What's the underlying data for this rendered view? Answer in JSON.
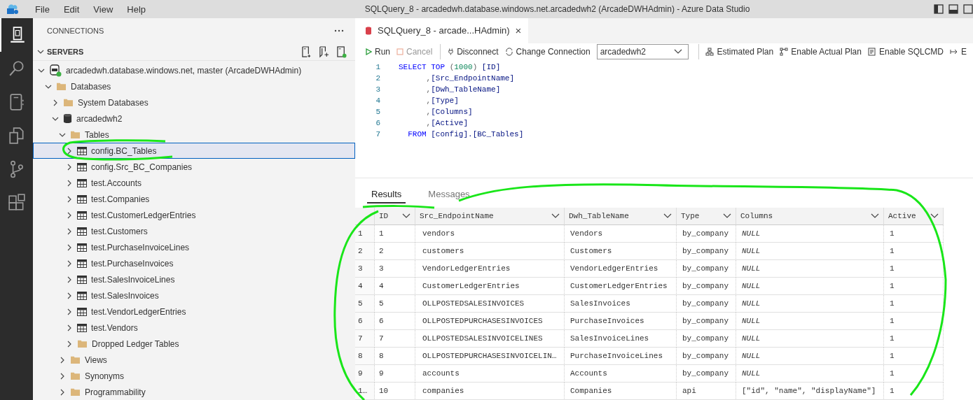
{
  "menu": [
    "File",
    "Edit",
    "View",
    "Help"
  ],
  "window": {
    "title": "SQLQuery_8 - arcadedwh.database.windows.net.arcadedwh2 (ArcadeDWHAdmin) - Azure Data Studio"
  },
  "sidebar": {
    "title": "CONNECTIONS",
    "section": "SERVERS",
    "tree": [
      {
        "label": "arcadedwh.database.windows.net, master (ArcadeDWHAdmin)",
        "kind": "server",
        "expanded": true,
        "selected": false,
        "children": [
          {
            "label": "Databases",
            "kind": "folder",
            "expanded": true,
            "selected": false,
            "children": [
              {
                "label": "System Databases",
                "kind": "folder",
                "expanded": false,
                "selected": false
              },
              {
                "label": "arcadedwh2",
                "kind": "database",
                "expanded": true,
                "selected": false,
                "children": [
                  {
                    "label": "Tables",
                    "kind": "folder",
                    "expanded": true,
                    "selected": false,
                    "children": [
                      {
                        "label": "config.BC_Tables",
                        "kind": "table",
                        "expanded": false,
                        "selected": true
                      },
                      {
                        "label": "config.Src_BC_Companies",
                        "kind": "table",
                        "expanded": false,
                        "selected": false
                      },
                      {
                        "label": "test.Accounts",
                        "kind": "table",
                        "expanded": false,
                        "selected": false
                      },
                      {
                        "label": "test.Companies",
                        "kind": "table",
                        "expanded": false,
                        "selected": false
                      },
                      {
                        "label": "test.CustomerLedgerEntries",
                        "kind": "table",
                        "expanded": false,
                        "selected": false
                      },
                      {
                        "label": "test.Customers",
                        "kind": "table",
                        "expanded": false,
                        "selected": false
                      },
                      {
                        "label": "test.PurchaseInvoiceLines",
                        "kind": "table",
                        "expanded": false,
                        "selected": false
                      },
                      {
                        "label": "test.PurchaseInvoices",
                        "kind": "table",
                        "expanded": false,
                        "selected": false
                      },
                      {
                        "label": "test.SalesInvoiceLines",
                        "kind": "table",
                        "expanded": false,
                        "selected": false
                      },
                      {
                        "label": "test.SalesInvoices",
                        "kind": "table",
                        "expanded": false,
                        "selected": false
                      },
                      {
                        "label": "test.VendorLedgerEntries",
                        "kind": "table",
                        "expanded": false,
                        "selected": false
                      },
                      {
                        "label": "test.Vendors",
                        "kind": "table",
                        "expanded": false,
                        "selected": false
                      },
                      {
                        "label": "Dropped Ledger Tables",
                        "kind": "folder",
                        "expanded": false,
                        "selected": false
                      }
                    ]
                  },
                  {
                    "label": "Views",
                    "kind": "folder",
                    "expanded": false,
                    "selected": false
                  },
                  {
                    "label": "Synonyms",
                    "kind": "folder",
                    "expanded": false,
                    "selected": false
                  },
                  {
                    "label": "Programmability",
                    "kind": "folder",
                    "expanded": false,
                    "selected": false
                  }
                ]
              }
            ]
          }
        ]
      }
    ]
  },
  "editor": {
    "tab": {
      "label": "SQLQuery_8 - arcade...HAdmin)",
      "close": "×"
    },
    "toolbar": [
      {
        "label": "Run",
        "kind": "run",
        "disabled": false
      },
      {
        "label": "Cancel",
        "kind": "cancel",
        "disabled": true
      },
      {
        "label": "Disconnect",
        "kind": "disconnect",
        "disabled": false
      },
      {
        "label": "Change Connection",
        "kind": "change",
        "disabled": false
      },
      {
        "value": "arcadedwh2",
        "kind": "dropdown"
      },
      {
        "label": "Estimated Plan",
        "kind": "plan",
        "disabled": false
      },
      {
        "label": "Enable Actual Plan",
        "kind": "actual",
        "disabled": false
      },
      {
        "label": "Enable SQLCMD",
        "kind": "sqlcmd",
        "disabled": false
      },
      {
        "label": "E",
        "kind": "export",
        "disabled": false
      }
    ],
    "code": [
      {
        "number": "1",
        "tokens": [
          {
            "text": "SELECT TOP ",
            "kind": "keyword"
          },
          {
            "text": "(",
            "kind": "punct"
          },
          {
            "text": "1000",
            "kind": "number"
          },
          {
            "text": ") ",
            "kind": "punct"
          },
          {
            "text": "[ID]",
            "kind": "ident"
          }
        ]
      },
      {
        "number": "2",
        "tokens": [
          {
            "text": "      ,",
            "kind": "punct"
          },
          {
            "text": "[Src_EndpointName]",
            "kind": "ident"
          }
        ]
      },
      {
        "number": "3",
        "tokens": [
          {
            "text": "      ,",
            "kind": "punct"
          },
          {
            "text": "[Dwh_TableName]",
            "kind": "ident"
          }
        ]
      },
      {
        "number": "4",
        "tokens": [
          {
            "text": "      ,",
            "kind": "punct"
          },
          {
            "text": "[Type]",
            "kind": "ident"
          }
        ]
      },
      {
        "number": "5",
        "tokens": [
          {
            "text": "      ,",
            "kind": "punct"
          },
          {
            "text": "[Columns]",
            "kind": "ident"
          }
        ]
      },
      {
        "number": "6",
        "tokens": [
          {
            "text": "      ,",
            "kind": "punct"
          },
          {
            "text": "[Active]",
            "kind": "ident"
          }
        ]
      },
      {
        "number": "7",
        "tokens": [
          {
            "text": "  FROM ",
            "kind": "keyword"
          },
          {
            "text": "[config].[BC_Tables]",
            "kind": "ident"
          }
        ]
      }
    ]
  },
  "results": {
    "tabs": [
      {
        "label": "Results",
        "selected": true
      },
      {
        "label": "Messages",
        "selected": false
      }
    ],
    "columns": [
      "ID",
      "Src_EndpointName",
      "Dwh_TableName",
      "Type",
      "Columns",
      "Active"
    ],
    "rows": [
      {
        "row": "1",
        "cells": [
          "1",
          "vendors",
          "Vendors",
          "by_company",
          "NULL",
          "1"
        ],
        "columns_null": true
      },
      {
        "row": "2",
        "cells": [
          "2",
          "customers",
          "Customers",
          "by_company",
          "NULL",
          "1"
        ],
        "columns_null": true
      },
      {
        "row": "3",
        "cells": [
          "3",
          "VendorLedgerEntries",
          "VendorLedgerEntries",
          "by_company",
          "NULL",
          "1"
        ],
        "columns_null": true
      },
      {
        "row": "4",
        "cells": [
          "4",
          "CustomerLedgerEntries",
          "CustomerLedgerEntries",
          "by_company",
          "NULL",
          "1"
        ],
        "columns_null": true
      },
      {
        "row": "5",
        "cells": [
          "5",
          "OLLPOSTEDSALESINVOICES",
          "SalesInvoices",
          "by_company",
          "NULL",
          "1"
        ],
        "columns_null": true
      },
      {
        "row": "6",
        "cells": [
          "6",
          "OLLPOSTEDPURCHASESINVOICES",
          "PurchaseInvoices",
          "by_company",
          "NULL",
          "1"
        ],
        "columns_null": true
      },
      {
        "row": "7",
        "cells": [
          "7",
          "OLLPOSTEDSALESINVOICELINES",
          "SalesInvoiceLines",
          "by_company",
          "NULL",
          "1"
        ],
        "columns_null": true
      },
      {
        "row": "8",
        "cells": [
          "8",
          "OLLPOSTEDPURCHASESINVOICELIN…",
          "PurchaseInvoiceLines",
          "by_company",
          "NULL",
          "1"
        ],
        "columns_null": true
      },
      {
        "row": "9",
        "cells": [
          "9",
          "accounts",
          "Accounts",
          "by_company",
          "NULL",
          "1"
        ],
        "columns_null": true
      },
      {
        "row": "1…",
        "cells": [
          "10",
          "companies",
          "Companies",
          "api",
          "[\"id\", \"name\", \"displayName\"]",
          "1"
        ],
        "columns_null": false
      }
    ]
  }
}
